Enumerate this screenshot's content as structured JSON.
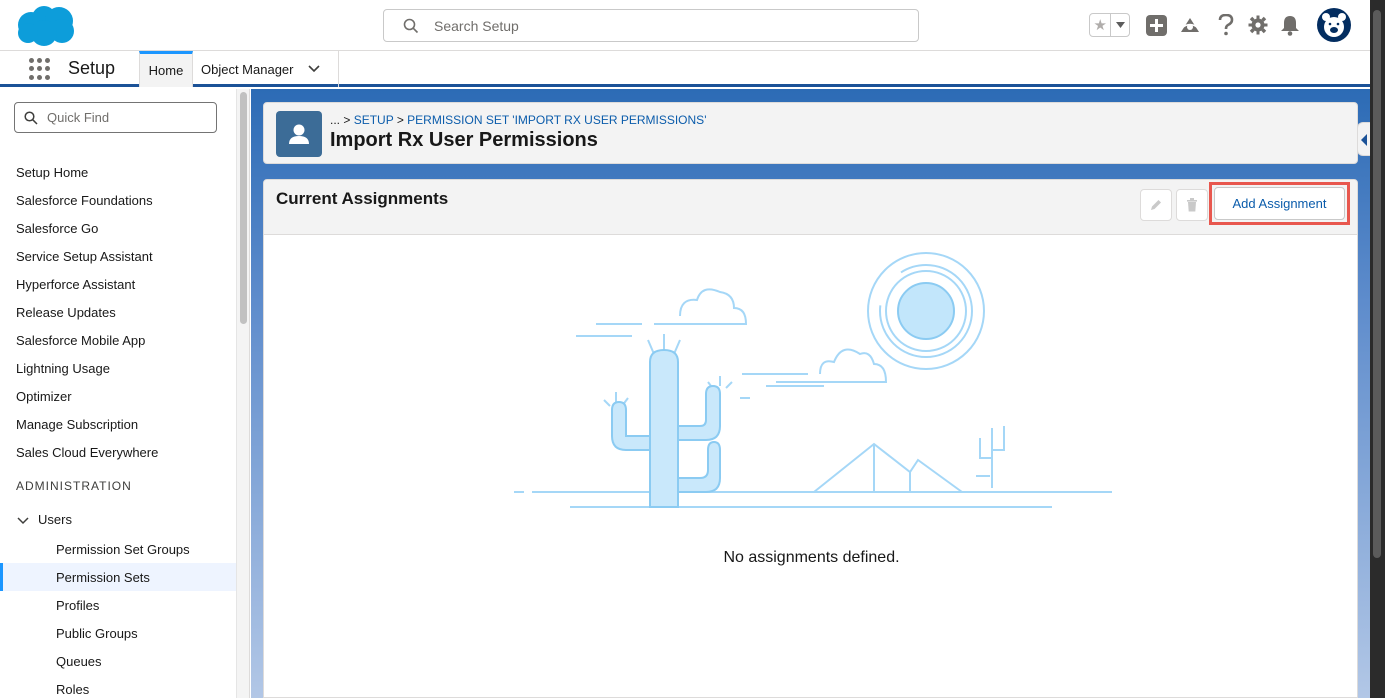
{
  "header": {
    "search_placeholder": "Search Setup",
    "icons": [
      "salesforce-logo",
      "search-icon",
      "star-icon",
      "chevron-down-icon",
      "add-icon",
      "trailhead-icon",
      "help-icon",
      "gear-icon",
      "bell-icon",
      "avatar"
    ]
  },
  "context_bar": {
    "app_name": "Setup",
    "tabs": [
      {
        "label": "Home",
        "active": true
      },
      {
        "label": "Object Manager",
        "active": false
      }
    ]
  },
  "sidebar": {
    "quick_find_placeholder": "Quick Find",
    "items": [
      "Setup Home",
      "Salesforce Foundations",
      "Salesforce Go",
      "Service Setup Assistant",
      "Hyperforce Assistant",
      "Release Updates",
      "Salesforce Mobile App",
      "Lightning Usage",
      "Optimizer",
      "Manage Subscription",
      "Sales Cloud Everywhere"
    ],
    "section": "ADMINISTRATION",
    "parent": "Users",
    "subitems": [
      {
        "label": "Permission Set Groups",
        "active": false
      },
      {
        "label": "Permission Sets",
        "active": true
      },
      {
        "label": "Profiles",
        "active": false
      },
      {
        "label": "Public Groups",
        "active": false
      },
      {
        "label": "Queues",
        "active": false
      },
      {
        "label": "Roles",
        "active": false
      }
    ]
  },
  "page_header": {
    "breadcrumb_prefix": "... > ",
    "breadcrumb_setup": "SETUP",
    "breadcrumb_sep": " > ",
    "breadcrumb_permset": "PERMISSION SET 'IMPORT RX USER PERMISSIONS'",
    "title": "Import Rx User Permissions"
  },
  "card": {
    "title": "Current Assignments",
    "add_button": "Add Assignment",
    "empty_message": "No assignments defined."
  },
  "colors": {
    "brand_blue": "#0b5cab",
    "active_tab": "#1b96ff",
    "highlight": "#e8574e",
    "page_icon": "#3c6c97"
  }
}
